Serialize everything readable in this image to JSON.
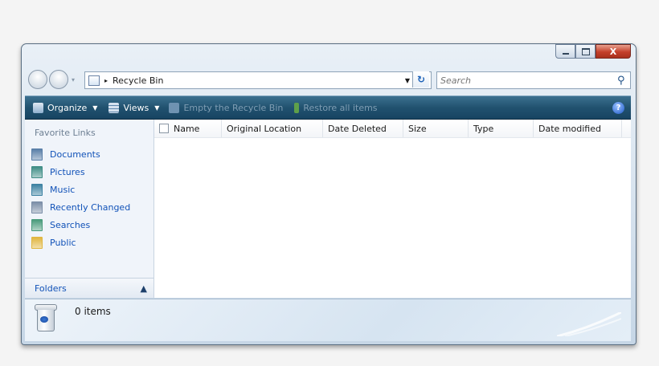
{
  "window": {
    "caption_buttons": {
      "minimize": "minimize",
      "maximize": "maximize",
      "close": "X"
    }
  },
  "address_bar": {
    "location": "Recycle Bin",
    "separator": "▸"
  },
  "search": {
    "placeholder": "Search"
  },
  "toolbar": {
    "organize": "Organize",
    "views": "Views",
    "empty": "Empty the Recycle Bin",
    "restore": "Restore all items",
    "help": "?"
  },
  "sidebar": {
    "favorite_links_title": "Favorite Links",
    "links": [
      {
        "label": "Documents",
        "icon": "documents-icon",
        "color": "#5a7fa8"
      },
      {
        "label": "Pictures",
        "icon": "pictures-icon",
        "color": "#3f8d86"
      },
      {
        "label": "Music",
        "icon": "music-icon",
        "color": "#3d82a3"
      },
      {
        "label": "Recently Changed",
        "icon": "recently-changed-icon",
        "color": "#7b8ea8"
      },
      {
        "label": "Searches",
        "icon": "searches-icon",
        "color": "#4a9b7c"
      },
      {
        "label": "Public",
        "icon": "public-folder-icon",
        "color": "#e0b640"
      }
    ],
    "folders_label": "Folders"
  },
  "columns": [
    {
      "label": "Name"
    },
    {
      "label": "Original Location"
    },
    {
      "label": "Date Deleted"
    },
    {
      "label": "Size"
    },
    {
      "label": "Type"
    },
    {
      "label": "Date modified"
    }
  ],
  "status": {
    "item_count": "0 items"
  }
}
